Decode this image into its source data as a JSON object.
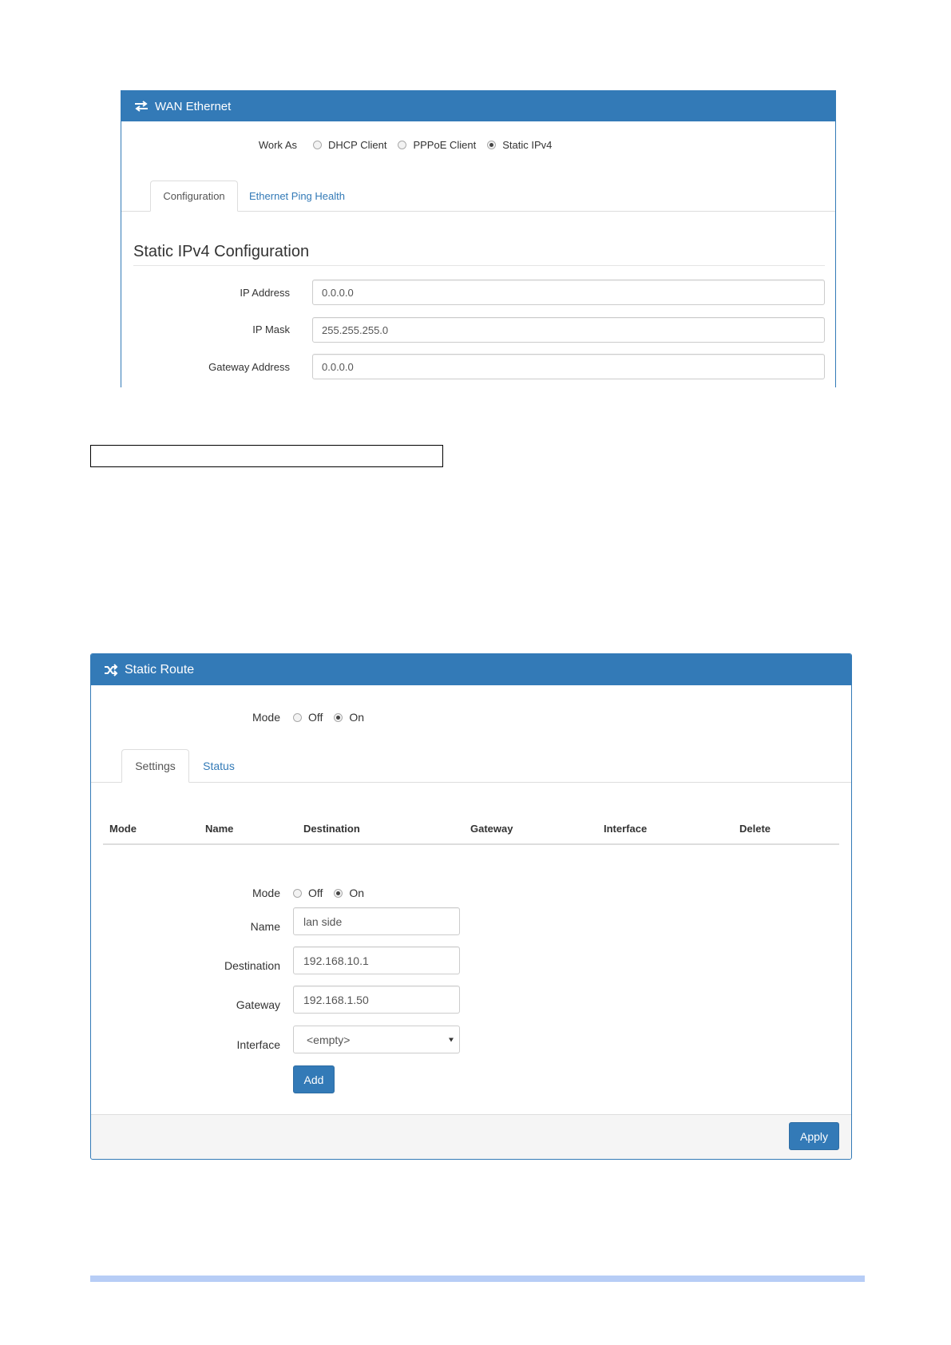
{
  "wan_ethernet": {
    "title": "WAN Ethernet",
    "icon": "exchange-arrows-icon",
    "work_as": {
      "label": "Work As",
      "options": [
        "DHCP Client",
        "PPPoE Client",
        "Static IPv4"
      ],
      "selected": "Static IPv4"
    },
    "tabs": [
      {
        "label": "Configuration",
        "active": true
      },
      {
        "label": "Ethernet Ping Health",
        "active": false
      }
    ],
    "section_title": "Static IPv4 Configuration",
    "fields": [
      {
        "label": "IP Address",
        "value": "0.0.0.0"
      },
      {
        "label": "IP Mask",
        "value": "255.255.255.0"
      },
      {
        "label": "Gateway Address",
        "value": "0.0.0.0"
      }
    ]
  },
  "static_route": {
    "title": "Static Route",
    "icon": "shuffle-icon",
    "mode": {
      "label": "Mode",
      "options": [
        "Off",
        "On"
      ],
      "selected": "On"
    },
    "tabs": [
      {
        "label": "Settings",
        "active": true
      },
      {
        "label": "Status",
        "active": false
      }
    ],
    "table_headers": [
      "Mode",
      "Name",
      "Destination",
      "Gateway",
      "Interface",
      "Delete"
    ],
    "form": {
      "mode": {
        "label": "Mode",
        "options": [
          "Off",
          "On"
        ],
        "selected": "On"
      },
      "name": {
        "label": "Name",
        "value": "lan side"
      },
      "destination": {
        "label": "Destination",
        "value": "192.168.10.1"
      },
      "gateway": {
        "label": "Gateway",
        "value": "192.168.1.50"
      },
      "interface": {
        "label": "Interface",
        "value": "<empty>"
      },
      "add_label": "Add"
    },
    "apply_label": "Apply"
  },
  "colors": {
    "primary": "#337ab7",
    "footer_bar": "#b7cdf6"
  }
}
